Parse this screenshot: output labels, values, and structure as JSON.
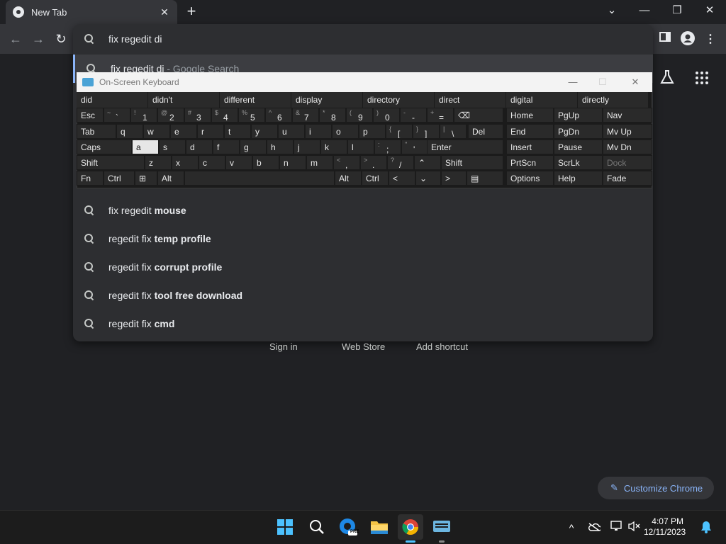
{
  "tab": {
    "title": "New Tab",
    "close": "✕"
  },
  "new_tab": "+",
  "window": {
    "min": "—",
    "restore": "❐",
    "close": "✕",
    "tablist": "⌄"
  },
  "nav": {
    "back": "←",
    "forward": "→",
    "reload": "↻"
  },
  "omnibox": {
    "text": "fix regedit di"
  },
  "suggestions": [
    {
      "plain": "fix regedit di",
      "dim": " - Google Search",
      "bold": ""
    },
    {
      "plain": "fix regedit ",
      "bold": "mouse"
    },
    {
      "plain": "regedit fix ",
      "bold": "temp profile"
    },
    {
      "plain": "regedit fix ",
      "bold": "corrupt profile"
    },
    {
      "plain": "regedit fix ",
      "bold": "tool free download"
    },
    {
      "plain": "regedit fix ",
      "bold": "cmd"
    }
  ],
  "newtab_links": [
    "Sign in",
    "Web Store",
    "Add shortcut"
  ],
  "customize": "Customize Chrome",
  "osk": {
    "title": "On-Screen Keyboard",
    "predictions": [
      "did",
      "didn't",
      "different",
      "display",
      "directory",
      "direct",
      "digital",
      "directly"
    ],
    "row1": [
      {
        "s": "~",
        "m": "`"
      },
      {
        "s": "!",
        "m": "1"
      },
      {
        "s": "@",
        "m": "2"
      },
      {
        "s": "#",
        "m": "3"
      },
      {
        "s": "$",
        "m": "4"
      },
      {
        "s": "%",
        "m": "5"
      },
      {
        "s": "^",
        "m": "6"
      },
      {
        "s": "&",
        "m": "7"
      },
      {
        "s": "*",
        "m": "8"
      },
      {
        "s": "(",
        "m": "9"
      },
      {
        "s": ")",
        "m": "0"
      },
      {
        "s": "-",
        "m": "-"
      },
      {
        "s": "+",
        "m": "="
      }
    ],
    "row2": [
      "q",
      "w",
      "e",
      "r",
      "t",
      "y",
      "u",
      "i",
      "o",
      "p"
    ],
    "row2b": [
      {
        "s": "{",
        "m": "["
      },
      {
        "s": "}",
        "m": "]"
      },
      {
        "s": "|",
        "m": "\\"
      }
    ],
    "row3": [
      "a",
      "s",
      "d",
      "f",
      "g",
      "h",
      "j",
      "k",
      "l"
    ],
    "row3b": [
      {
        "s": ":",
        "m": ";"
      },
      {
        "s": "\"",
        "m": "'"
      }
    ],
    "row4": [
      "z",
      "x",
      "c",
      "v",
      "b",
      "n",
      "m"
    ],
    "row4b": [
      {
        "s": "<",
        "m": ","
      },
      {
        "s": ">",
        "m": "."
      },
      {
        "s": "?",
        "m": "/"
      }
    ],
    "keys": {
      "esc": "Esc",
      "tab": "Tab",
      "caps": "Caps",
      "shift": "Shift",
      "fn": "Fn",
      "ctrl": "Ctrl",
      "alt": "Alt",
      "del": "Del",
      "enter": "Enter",
      "bksp": "⌫",
      "up": "⌃",
      "down": "⌄",
      "left": "<",
      "right": ">",
      "menu": "▤",
      "win": "⊞"
    },
    "nav": [
      [
        "Home",
        "PgUp",
        "Nav"
      ],
      [
        "End",
        "PgDn",
        "Mv Up"
      ],
      [
        "Insert",
        "Pause",
        "Mv Dn"
      ],
      [
        "PrtScn",
        "ScrLk",
        "Dock"
      ],
      [
        "Options",
        "Help",
        "Fade"
      ]
    ]
  },
  "taskbar": {
    "time": "4:07 PM",
    "date": "12/11/2023",
    "pre": "PRE"
  },
  "tray": {
    "chevron": "^",
    "bell": "🔔"
  }
}
